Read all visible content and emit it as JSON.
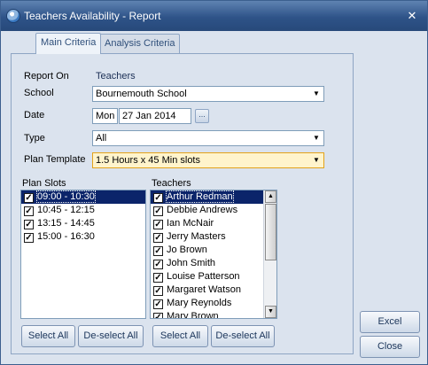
{
  "window": {
    "title": "Teachers Availability - Report"
  },
  "tabs": [
    {
      "label": "Main Criteria",
      "active": true
    },
    {
      "label": "Analysis Criteria",
      "active": false
    }
  ],
  "form": {
    "report_on_label": "Report On",
    "report_on_value": "Teachers",
    "school_label": "School",
    "school_value": "Bournemouth School",
    "date_label": "Date",
    "date_day": "Mon",
    "date_value": "27 Jan 2014",
    "date_picker_label": "...",
    "type_label": "Type",
    "type_value": "All",
    "plan_template_label": "Plan Template",
    "plan_template_value": "1.5 Hours x 45 Min slots"
  },
  "plan_slots": {
    "label": "Plan Slots",
    "items": [
      {
        "text": "09:00 - 10:30",
        "checked": true,
        "selected": true
      },
      {
        "text": "10:45 - 12:15",
        "checked": true,
        "selected": false
      },
      {
        "text": "13:15 - 14:45",
        "checked": true,
        "selected": false
      },
      {
        "text": "15:00 - 16:30",
        "checked": true,
        "selected": false
      }
    ],
    "select_all_label": "Select All",
    "deselect_all_label": "De-select All"
  },
  "teachers": {
    "label": "Teachers",
    "items": [
      {
        "text": "Arthur Redman",
        "checked": true,
        "selected": true
      },
      {
        "text": "Debbie Andrews",
        "checked": true,
        "selected": false
      },
      {
        "text": "Ian McNair",
        "checked": true,
        "selected": false
      },
      {
        "text": "Jerry Masters",
        "checked": true,
        "selected": false
      },
      {
        "text": "Jo Brown",
        "checked": true,
        "selected": false
      },
      {
        "text": "John Smith",
        "checked": true,
        "selected": false
      },
      {
        "text": "Louise Patterson",
        "checked": true,
        "selected": false
      },
      {
        "text": "Margaret Watson",
        "checked": true,
        "selected": false
      },
      {
        "text": "Mary Reynolds",
        "checked": true,
        "selected": false
      },
      {
        "text": "Mary Brown",
        "checked": true,
        "selected": false
      }
    ],
    "select_all_label": "Select All",
    "deselect_all_label": "De-select All"
  },
  "actions": {
    "excel_label": "Excel",
    "close_label": "Close"
  },
  "colors": {
    "title_bar": "#2e5388",
    "selection": "#0b246a",
    "highlight_field": "#fff4cc"
  }
}
